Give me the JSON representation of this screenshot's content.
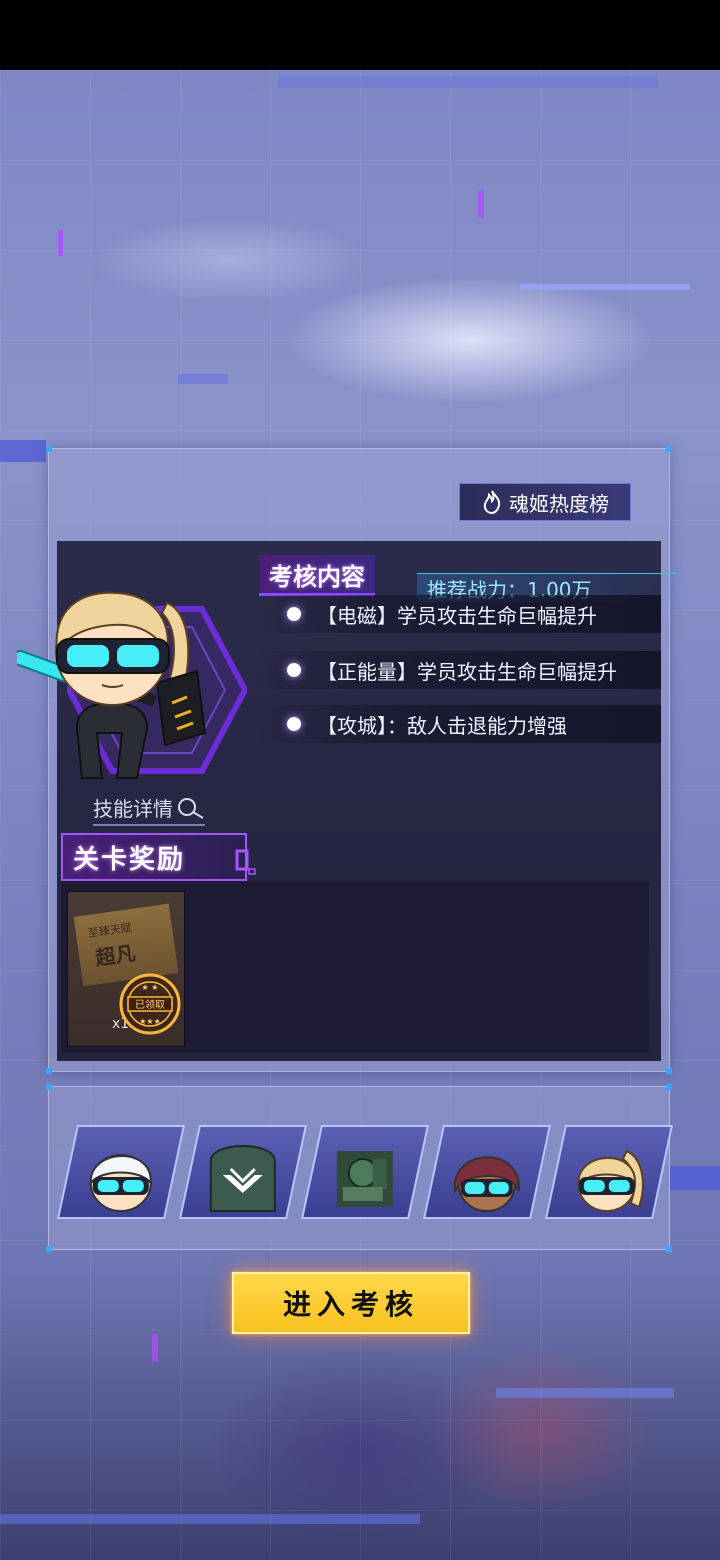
{
  "rank_button": {
    "label": "魂姬热度榜",
    "icon": "flame-icon"
  },
  "character": {
    "skill_detail_label": "技能详情"
  },
  "exam": {
    "title": "考核内容",
    "recommended_power": "推荐战力：1.00万",
    "conditions": [
      "【电磁】学员攻击生命巨幅提升",
      "【正能量】学员攻击生命巨幅提升",
      "【攻城】：敌人击退能力增强"
    ]
  },
  "rewards": {
    "title": "关卡奖励",
    "items": [
      {
        "label_small": "至臻天赋",
        "label_big": "超凡",
        "quantity": "x1",
        "stamp": "已领取"
      }
    ]
  },
  "team": {
    "members": [
      "white-hair-goggles",
      "green-hood-emblem",
      "green-mech",
      "maroon-hair-goggles",
      "blonde-ponytail-goggles"
    ]
  },
  "enter_button": {
    "label": "进入考核"
  },
  "colors": {
    "accent_purple": "#a455ff",
    "accent_cyan": "#3ec8ff",
    "button_yellow": "#f7c21e"
  }
}
